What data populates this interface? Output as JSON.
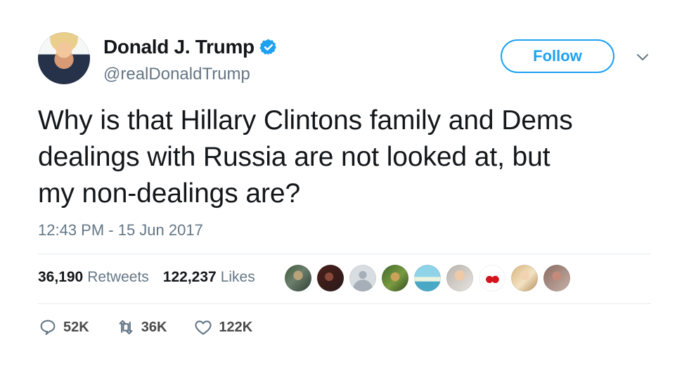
{
  "author": {
    "display_name": "Donald J. Trump",
    "handle": "@realDonaldTrump",
    "verified": true
  },
  "follow_label": "Follow",
  "tweet": {
    "text_lines": [
      "Why is that Hillary Clintons family and Dems",
      "dealings with Russia are not looked at, but",
      "my non-dealings are?"
    ],
    "timestamp": "12:43 PM - 15 Jun 2017"
  },
  "stats": {
    "retweets_count": "36,190",
    "retweets_label": "Retweets",
    "likes_count": "122,237",
    "likes_label": "Likes"
  },
  "actions": {
    "reply_count": "52K",
    "retweet_count": "36K",
    "like_count": "122K"
  },
  "colors": {
    "accent": "#1da1f2",
    "text": "#14171a",
    "muted": "#657786",
    "divider": "#e6ecf0",
    "like_heart": "#e0245e"
  },
  "icons": {
    "verified": "verified-badge-icon",
    "caret": "chevron-down-icon",
    "reply": "reply-icon",
    "retweet": "retweet-icon",
    "like": "heart-icon"
  }
}
